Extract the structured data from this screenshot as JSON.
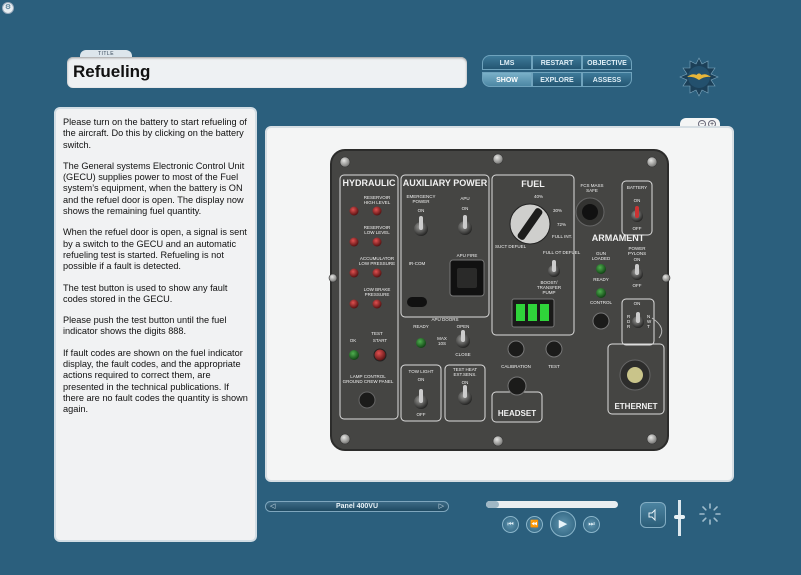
{
  "header": {
    "title_tag": "TITLE",
    "title": "Refueling"
  },
  "nav": {
    "lms": "LMS",
    "restart": "RESTART",
    "objective": "OBJECTIVE",
    "show": "SHOW",
    "explore": "EXPLORE",
    "assess": "ASSESS"
  },
  "instructions": [
    "Please turn on the battery to start refueling of the aircraft. Do this by clicking on the battery switch.",
    "The General systems Electronic Control Unit (GECU) supplies power to most of the Fuel system’s equipment, when the battery is ON and the refuel door is open. The display now shows the remaining fuel quantity.",
    "When the refuel door is open, a signal is sent by a switch to the GECU and an automatic refueling test is started. Refueling is not possible if a fault is detected.",
    "The test button is used to show any fault codes stored in the GECU.",
    "Please push the test button until the fuel indicator shows the digits 888.",
    "If fault codes are shown on the fuel indicator display, the fault codes, and the appropriate actions required to correct them, are presented in the technical publications. If there are no fault codes the quantity is shown again."
  ],
  "panel": {
    "hydraulic": {
      "title": "HYDRAULIC",
      "reservoir_high": "RESERVOIR\nHIGH LEVEL",
      "reservoir_low": "RESERVOIR\nLOW LEVEL",
      "accumulator": "ACCUMULATOR\nLOW PRESSURE",
      "low_brake": "LOW BRAKE\nPRESSURE",
      "test": "TEST",
      "ok": "OK",
      "start": "START",
      "lamp_control": "LAMP CONTROL\nGROUND CREW PANEL"
    },
    "aux_power": {
      "title": "AUXILIARY POWER",
      "emergency_power": "EMERGENCY\nPOWER",
      "on": "ON",
      "apu": "APU",
      "ir_com": "IR-COM",
      "apu_fire": "APU FIRE",
      "apu_doors": "APU DOORS",
      "ready": "READY",
      "open": "OPEN",
      "max": "MAX\n10S",
      "close": "CLOSE",
      "tow_light": "TOW LIGHT",
      "test_heat": "TEST HEAT\nEXT.SENS.",
      "off": "OFF"
    },
    "fuel": {
      "title": "FUEL",
      "pct_40": "40%",
      "pct_30": "30%",
      "pct_72": "72%",
      "full_int": "FULL INT.",
      "full_ot": "FULL OT DEFUEL",
      "defuel": "SUCT DEFUEL",
      "n1": "1",
      "n2": "2",
      "n3": "3",
      "n4": "4",
      "n5": "5",
      "n6": "6",
      "boost": "BOOST/\nTRANSFER\nPUMP",
      "calibration": "CALIBRATION",
      "test": "TEST",
      "headset": "HEADSET"
    },
    "armament": {
      "fcs_mass": "FCS MASS\nSAFE",
      "battery": "BATTERY",
      "on": "ON",
      "off": "OFF",
      "title": "ARMAMENT",
      "gun_loaded": "GUN\nLOADED",
      "power_pylons": "POWER\nPYLONS",
      "ready": "READY",
      "control": "CONTROL",
      "rdr": "R\nD\nR",
      "nwt": "N\nW\nT",
      "ethernet": "ETHERNET"
    }
  },
  "footer": {
    "panel_label": "Panel 400VU",
    "progress_fraction": 0.1
  },
  "colors": {
    "background": "#2b5f7d",
    "panel_gray": "#4a4a48"
  }
}
